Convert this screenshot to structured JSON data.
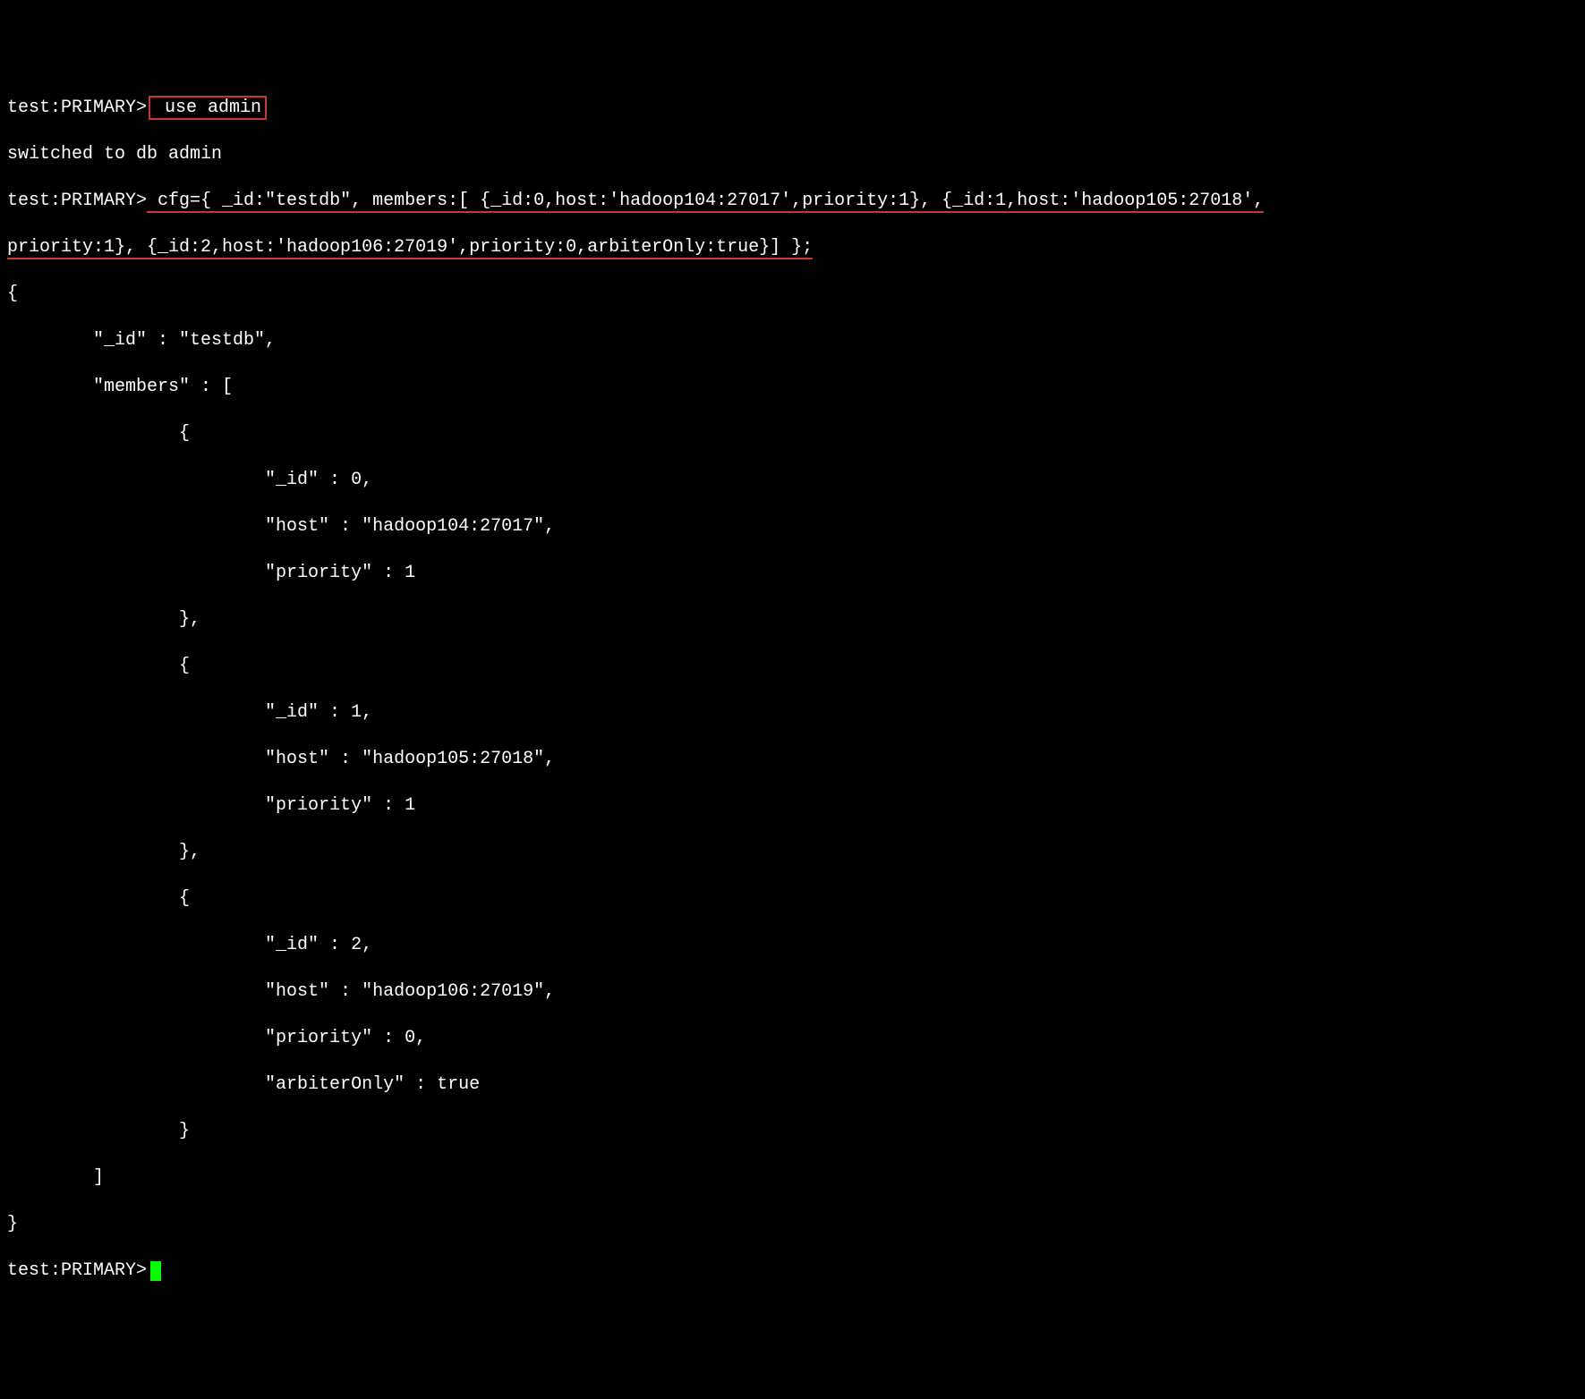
{
  "prompt": "test:PRIMARY>",
  "cmd1": " use admin",
  "resp1": "switched to db admin",
  "cmd2a": " cfg={ _id:\"testdb\", members:[ {_id:0,host:'hadoop104:27017',priority:1}, {_id:1,host:'hadoop105:27018',",
  "cmd2b": "priority:1}, {_id:2,host:'hadoop106:27019',priority:0,arbiterOnly:true}] };",
  "out": {
    "l1": "{",
    "l2": "        \"_id\" : \"testdb\",",
    "l3": "        \"members\" : [",
    "l4": "                {",
    "l5": "                        \"_id\" : 0,",
    "l6": "                        \"host\" : \"hadoop104:27017\",",
    "l7": "                        \"priority\" : 1",
    "l8": "                },",
    "l9": "                {",
    "l10": "                        \"_id\" : 1,",
    "l11": "                        \"host\" : \"hadoop105:27018\",",
    "l12": "                        \"priority\" : 1",
    "l13": "                },",
    "l14": "                {",
    "l15": "                        \"_id\" : 2,",
    "l16": "                        \"host\" : \"hadoop106:27019\",",
    "l17": "                        \"priority\" : 0,",
    "l18": "                        \"arbiterOnly\" : true",
    "l19": "                }",
    "l20": "        ]",
    "l21": "}"
  }
}
